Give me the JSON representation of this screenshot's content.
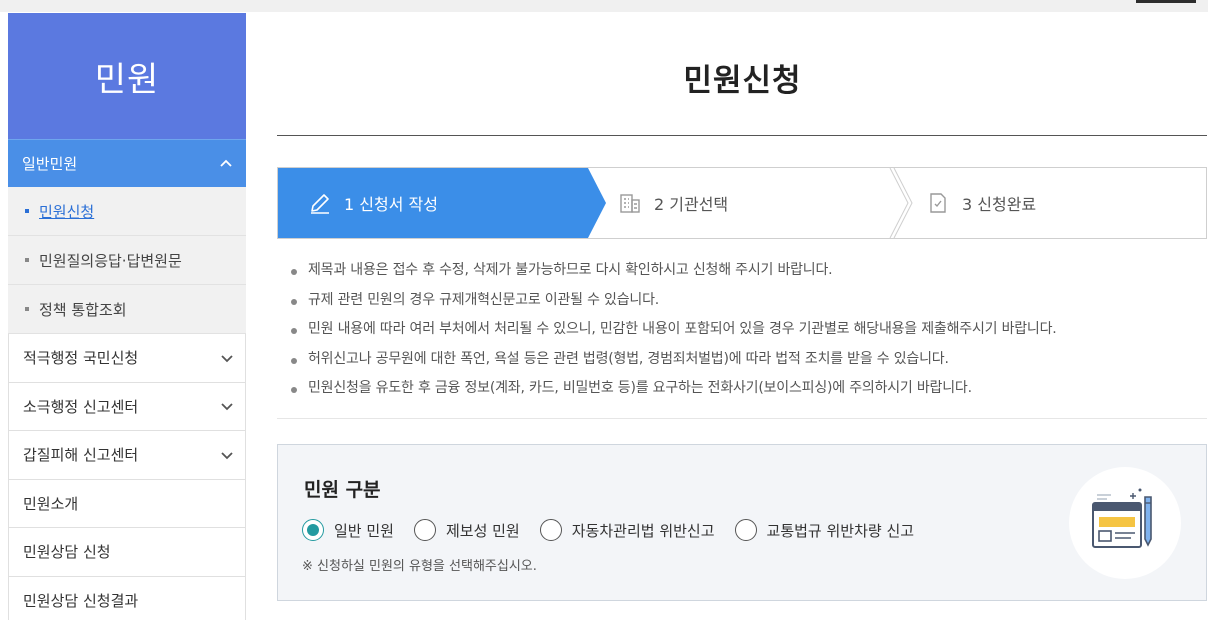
{
  "sidebar": {
    "title": "민원",
    "open_menu": "일반민원",
    "sub_items": [
      {
        "label": "민원신청",
        "active": true
      },
      {
        "label": "민원질의응답·답변원문",
        "active": false
      },
      {
        "label": "정책 통합조회",
        "active": false
      }
    ],
    "menu_items": [
      {
        "label": "적극행정 국민신청",
        "expandable": true
      },
      {
        "label": "소극행정 신고센터",
        "expandable": true
      },
      {
        "label": "갑질피해 신고센터",
        "expandable": true
      },
      {
        "label": "민원소개",
        "expandable": false
      },
      {
        "label": "민원상담 신청",
        "expandable": false
      },
      {
        "label": "민원상담 신청결과",
        "expandable": false
      }
    ]
  },
  "main": {
    "title": "민원신청",
    "steps": [
      {
        "label": "1 신청서 작성",
        "icon": "pencil-icon",
        "active": true
      },
      {
        "label": "2 기관선택",
        "icon": "building-icon",
        "active": false
      },
      {
        "label": "3 신청완료",
        "icon": "document-check-icon",
        "active": false
      }
    ],
    "notices": [
      "제목과 내용은 접수 후 수정, 삭제가 불가능하므로 다시 확인하시고 신청해 주시기 바랍니다.",
      "규제 관련 민원의 경우 규제개혁신문고로 이관될 수 있습니다.",
      "민원 내용에 따라 여러 부처에서 처리될 수 있으니, 민감한 내용이 포함되어 있을 경우 기관별로 해당내용을 제출해주시기 바랍니다.",
      "허위신고나 공무원에 대한 폭언, 욕설 등은 관련 법령(형법, 경범죄처벌법)에 따라 법적 조치를 받을 수 있습니다.",
      "민원신청을 유도한 후 금융 정보(계좌, 카드, 비밀번호 등)를 요구하는 전화사기(보이스피싱)에 주의하시기 바랍니다."
    ],
    "type_section": {
      "title": "민원 구분",
      "options": [
        {
          "label": "일반 민원",
          "selected": true
        },
        {
          "label": "제보성 민원",
          "selected": false
        },
        {
          "label": "자동차관리법 위반신고",
          "selected": false
        },
        {
          "label": "교통법규 위반차량 신고",
          "selected": false
        }
      ],
      "note": "※ 신청하실 민원의 유형을 선택해주십시오.",
      "illustration": "document-pen-icon"
    }
  },
  "colors": {
    "sidebar_header": "#5b79e0",
    "menu_active": "#4a8fe7",
    "step_active": "#3b8ee8",
    "radio_selected": "#239aa0"
  }
}
